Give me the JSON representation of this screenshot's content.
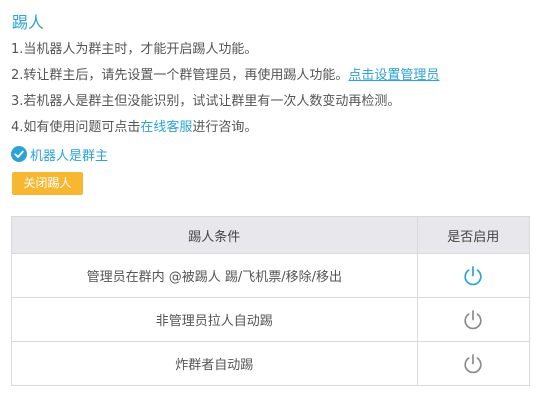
{
  "page": {
    "title": "踢人"
  },
  "instructions": {
    "line1": "1.当机器人为群主时，才能开启踢人功能。",
    "line2_text": "2.转让群主后，请先设置一个群管理员，再使用踢人功能。",
    "line2_link": "点击设置管理员",
    "line3": "3.若机器人是群主但没能识别，试试让群里有一次人数变动再检测。",
    "line4_prefix": "4.如有使用问题可点击",
    "line4_link": "在线客服",
    "line4_suffix": "进行咨询。"
  },
  "status": {
    "label": "机器人是群主",
    "icon": "check-circle-icon"
  },
  "toggle_button": {
    "label": "关闭踢人"
  },
  "table": {
    "headers": [
      "踢人条件",
      "是否启用"
    ],
    "rows": [
      {
        "condition": "管理员在群内 @被踢人 踢/飞机票/移除/移出",
        "enabled": true
      },
      {
        "condition": "非管理员拉人自动踢",
        "enabled": false
      },
      {
        "condition": "炸群者自动踢",
        "enabled": false
      }
    ]
  },
  "colors": {
    "accent": "#2ba3d6",
    "button": "#f7b731",
    "power_on": "#2ba3d6",
    "power_off": "#8a8a8a",
    "header_bg": "#e8e8ec"
  }
}
